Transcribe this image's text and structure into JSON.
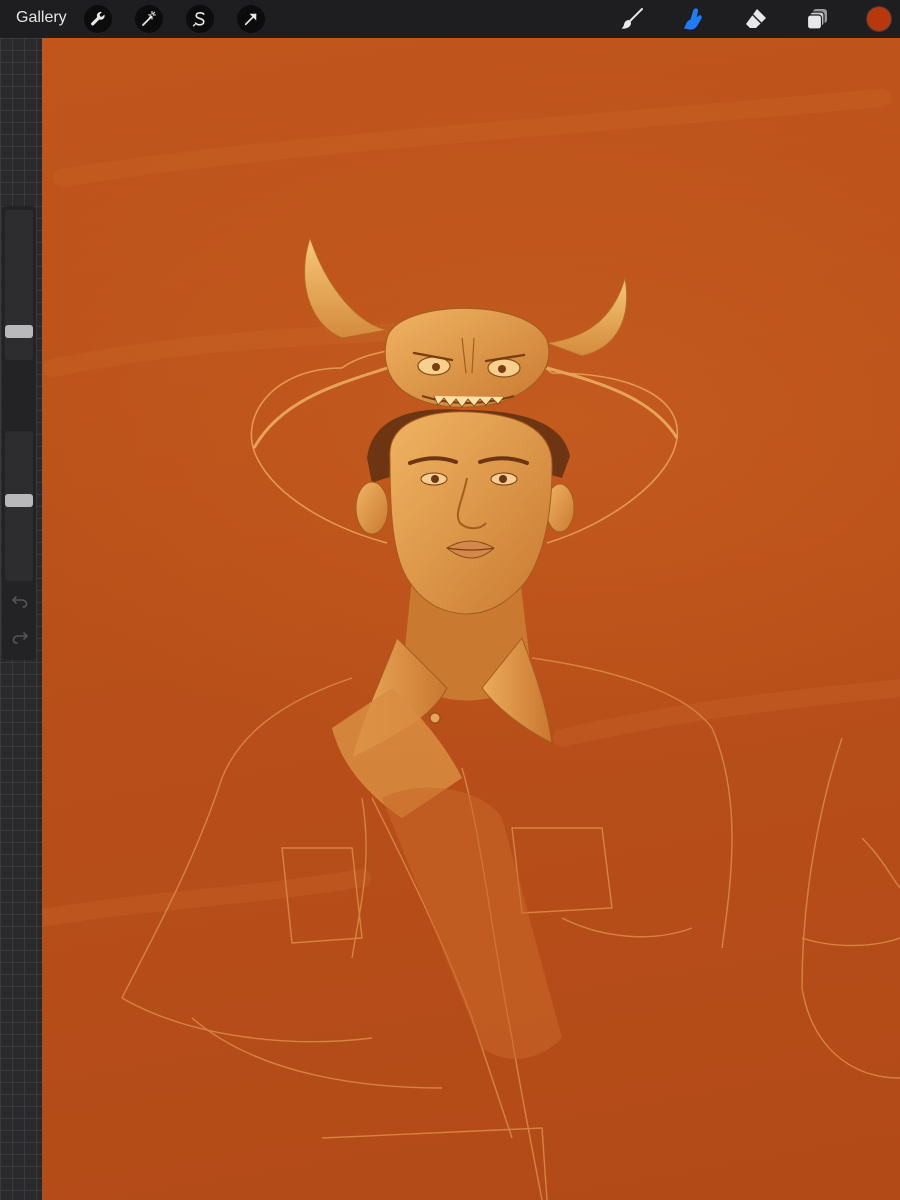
{
  "app": {
    "gallery_label": "Gallery"
  },
  "toolbar": {
    "left_tools": [
      {
        "name": "actions",
        "icon": "wrench-icon"
      },
      {
        "name": "adjustments",
        "icon": "magic-wand-icon"
      },
      {
        "name": "selection",
        "icon": "selection-s-icon"
      },
      {
        "name": "transform",
        "icon": "arrow-cursor-icon"
      }
    ],
    "right_tools": [
      {
        "name": "brush",
        "icon": "brush-icon",
        "active": false
      },
      {
        "name": "smudge",
        "icon": "smudge-finger-icon",
        "active": true
      },
      {
        "name": "eraser",
        "icon": "eraser-icon",
        "active": false
      },
      {
        "name": "layers",
        "icon": "layers-icon",
        "active": false
      }
    ],
    "active_tool_color": "#1f7cf5",
    "current_color": "#b8380e"
  },
  "sidebar": {
    "brush_size": 0.16,
    "brush_opacity": 0.54
  },
  "canvas": {
    "background_color": "#bf551c",
    "ink_color": "#e6a04a"
  }
}
